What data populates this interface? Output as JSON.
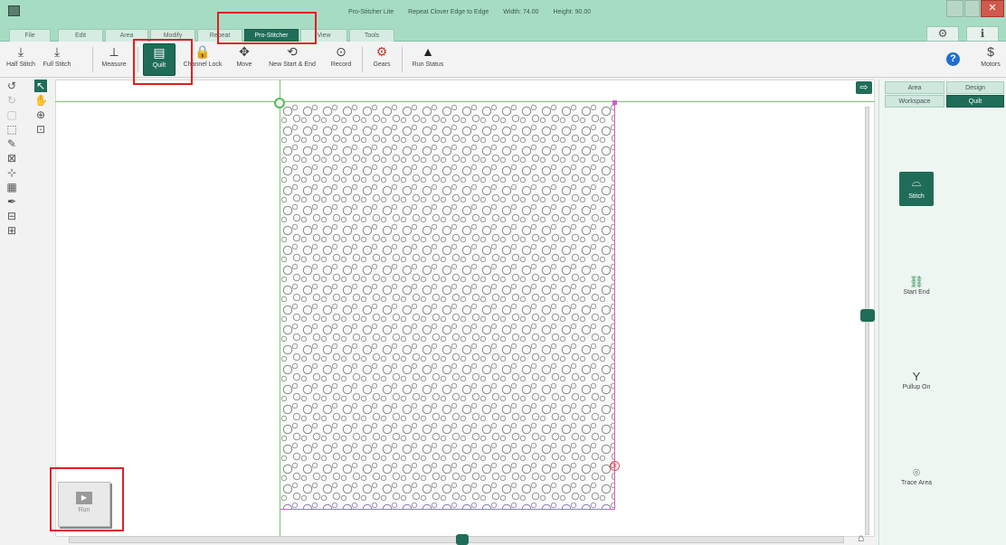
{
  "window": {
    "title_parts": [
      "Pro-Stitcher Lite",
      "Repeat Clover Edge to Edge",
      "Width: 74.00",
      "Height: 90.00"
    ],
    "minimize": "",
    "maximize": "",
    "close": "✕"
  },
  "menu": {
    "tabs": [
      "File",
      "Edit",
      "Area",
      "Modify",
      "Repeat",
      "Pro-Stitcher",
      "View",
      "Tools"
    ],
    "active": "Pro-Stitcher"
  },
  "right_controls": {
    "gear": "⚙",
    "info": "ℹ"
  },
  "toolbar": {
    "items": [
      {
        "label": "Half Stitch",
        "icon": "⤓"
      },
      {
        "label": "Full Stitch",
        "icon": "⤓"
      },
      {
        "label": "Measure",
        "icon": "⟂"
      },
      {
        "label": "Quilt",
        "icon": "▤"
      },
      {
        "label": "Channel Lock",
        "icon": "🔒"
      },
      {
        "label": "Move",
        "icon": "✥"
      },
      {
        "label": "New Start & End",
        "icon": "⟲"
      },
      {
        "label": "Record",
        "icon": "⊙"
      },
      {
        "label": "Gears",
        "icon": "⚙"
      },
      {
        "label": "Run Status",
        "icon": "▲"
      }
    ],
    "help": "?",
    "motors_label": "Motors",
    "motors_icon": "$"
  },
  "left_tools": [
    "↺",
    "↖",
    "↻",
    "✋",
    "▢",
    "⊕",
    "⬚",
    "⊡",
    "✎",
    "⊠",
    "⊹",
    "▦",
    "✒",
    "⊟",
    "⊞"
  ],
  "canvas": {
    "arrow": "⇨",
    "home": "⌂",
    "end_marker": "✕"
  },
  "run_button": {
    "label": "Run",
    "icon": "▶"
  },
  "right_panel": {
    "tabs_top": [
      "Area",
      "Design"
    ],
    "tabs_bottom": [
      "Workspace",
      "Quilt"
    ],
    "active_bottom": "Quilt",
    "tools": [
      {
        "label": "Stitch",
        "icon": "⌓"
      },
      {
        "label": "Start End",
        "icon": "⛓"
      },
      {
        "label": "Pullup On",
        "icon": "Y"
      },
      {
        "label": "Trace Area",
        "icon": "⌾"
      }
    ]
  }
}
